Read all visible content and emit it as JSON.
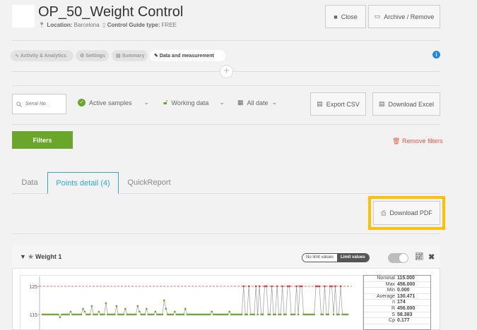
{
  "header": {
    "title": "OP_50_Weight Control",
    "location_label": "Location:",
    "location_value": "Barcelona",
    "guide_label": "Control Guide type:",
    "guide_value": "FREE",
    "close_label": "Close",
    "archive_label": "Archive / Remove"
  },
  "nav_tabs": [
    {
      "label": "Activity & Analytics",
      "icon": "pulse-icon"
    },
    {
      "label": "Settings",
      "icon": "gear-icon"
    },
    {
      "label": "Summary",
      "icon": "document-icon"
    },
    {
      "label": "Data and measurement",
      "icon": "pencil-icon",
      "active": true
    }
  ],
  "toolbar": {
    "serial_placeholder": "Serial No.",
    "active_samples": "Active samples",
    "working_data": "Working data",
    "all_date": "All date",
    "export_csv": "Export CSV",
    "download_excel": "Download Excel",
    "filters": "Filters",
    "remove_filters": "Remove filters"
  },
  "content_tabs": [
    {
      "label": "Data"
    },
    {
      "label": "Points detail (4)",
      "active": true
    },
    {
      "label": "QuickReport"
    }
  ],
  "download_pdf": "Download PDF",
  "panel": {
    "title": "Weight 1",
    "no_limit": "No limit values",
    "limit": "Limit values"
  },
  "chart_data": {
    "type": "line",
    "y_tick_labels": [
      "125",
      "115"
    ],
    "ylim": [
      112,
      126
    ],
    "reference_line": 125,
    "values": [
      115,
      115,
      115,
      115,
      115,
      115,
      115,
      115,
      115,
      115,
      114,
      115,
      115,
      115,
      115,
      115,
      116,
      115,
      115,
      115,
      115,
      115,
      115,
      117,
      116,
      115,
      115,
      115,
      118,
      115,
      115,
      115,
      116,
      115,
      115,
      115,
      119,
      115,
      115,
      115,
      115,
      115,
      118,
      115,
      115,
      115,
      115,
      117,
      115,
      115,
      115,
      115,
      115,
      115,
      118,
      116,
      115,
      115,
      115,
      117,
      115,
      115,
      115,
      115,
      116,
      115,
      115,
      115,
      115,
      120,
      117,
      115,
      115,
      115,
      115,
      116,
      115,
      115,
      115,
      115,
      115,
      117,
      115,
      115,
      115,
      115,
      115,
      115,
      115,
      115,
      115,
      115,
      115,
      115,
      115,
      115,
      116,
      115,
      115,
      115,
      115,
      115,
      115,
      115,
      115,
      115,
      116,
      115,
      115,
      115,
      115,
      115,
      115,
      115,
      125,
      115,
      115,
      125,
      115,
      115,
      115,
      125,
      115,
      125,
      115,
      115,
      125,
      125,
      115,
      115,
      125,
      115,
      115,
      125,
      115,
      115,
      125,
      115,
      115,
      125,
      125,
      115,
      115,
      115,
      125,
      115,
      125,
      125,
      115,
      115,
      115,
      115,
      115,
      115,
      115,
      125,
      125,
      125,
      115,
      115,
      125,
      115,
      115,
      125,
      125,
      115,
      125,
      115,
      115,
      125,
      115,
      115,
      115,
      115
    ],
    "stats": [
      {
        "label": "Nominal",
        "value": "115.000"
      },
      {
        "label": "Max",
        "value": "456.000"
      },
      {
        "label": "Min",
        "value": "0.000"
      },
      {
        "label": "Average",
        "value": "130.471"
      },
      {
        "label": "n",
        "value": "174"
      },
      {
        "label": "R",
        "value": "456.000"
      },
      {
        "label": "S",
        "value": "58.383"
      },
      {
        "label": "Cp",
        "value": "0.177"
      }
    ],
    "colors": {
      "line": "#9e9e9e",
      "point_ok": "#6aa629",
      "point_out": "#e53935",
      "limit": "#e57373"
    }
  }
}
